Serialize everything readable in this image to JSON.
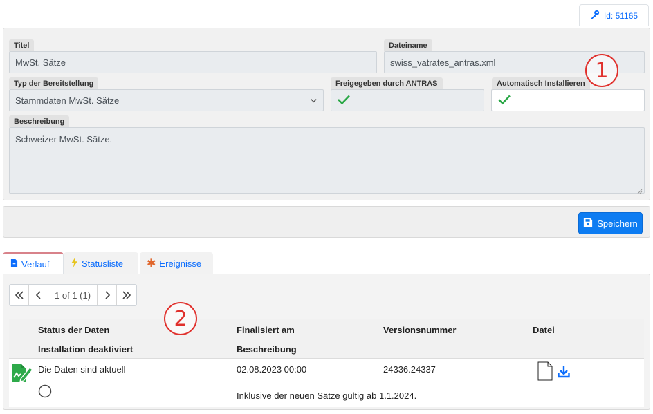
{
  "record": {
    "id_label": "Id: 51165"
  },
  "form": {
    "title_label": "Titel",
    "title_value": "MwSt. Sätze",
    "filename_label": "Dateiname",
    "filename_value": "swiss_vatrates_antras.xml",
    "type_label": "Typ der Bereitstellung",
    "type_value": "Stammdaten MwSt. Sätze",
    "released_label": "Freigegeben durch ANTRAS",
    "released_checked": true,
    "autoinstall_label": "Automatisch Installieren",
    "autoinstall_checked": true,
    "description_label": "Beschreibung",
    "description_value": "Schweizer MwSt. Sätze."
  },
  "callouts": {
    "first": "1",
    "second": "2"
  },
  "toolbar": {
    "save_label": "Speichern"
  },
  "tabs": [
    {
      "label": "Verlauf",
      "icon": "document-icon",
      "active": true
    },
    {
      "label": "Statusliste",
      "icon": "lightning-icon",
      "active": false
    },
    {
      "label": "Ereignisse",
      "icon": "asterisk-icon",
      "active": false
    }
  ],
  "pager": {
    "text": "1 of 1 (1)"
  },
  "grid": {
    "headers": {
      "status": "Status der Daten",
      "finalized": "Finalisiert am",
      "version": "Versionsnummer",
      "file": "Datei",
      "install_disabled": "Installation deaktiviert",
      "description": "Beschreibung"
    },
    "rows": [
      {
        "status": "Die Daten sind aktuell",
        "finalized": "02.08.2023 00:00",
        "version": "24336.24337",
        "description": "Inklusive der neuen Sätze gültig ab 1.1.2024."
      }
    ]
  },
  "colors": {
    "accent": "#0d6efd",
    "check": "#28a745",
    "callout": "#e0302c",
    "status_icon": "#2eaa4a"
  }
}
